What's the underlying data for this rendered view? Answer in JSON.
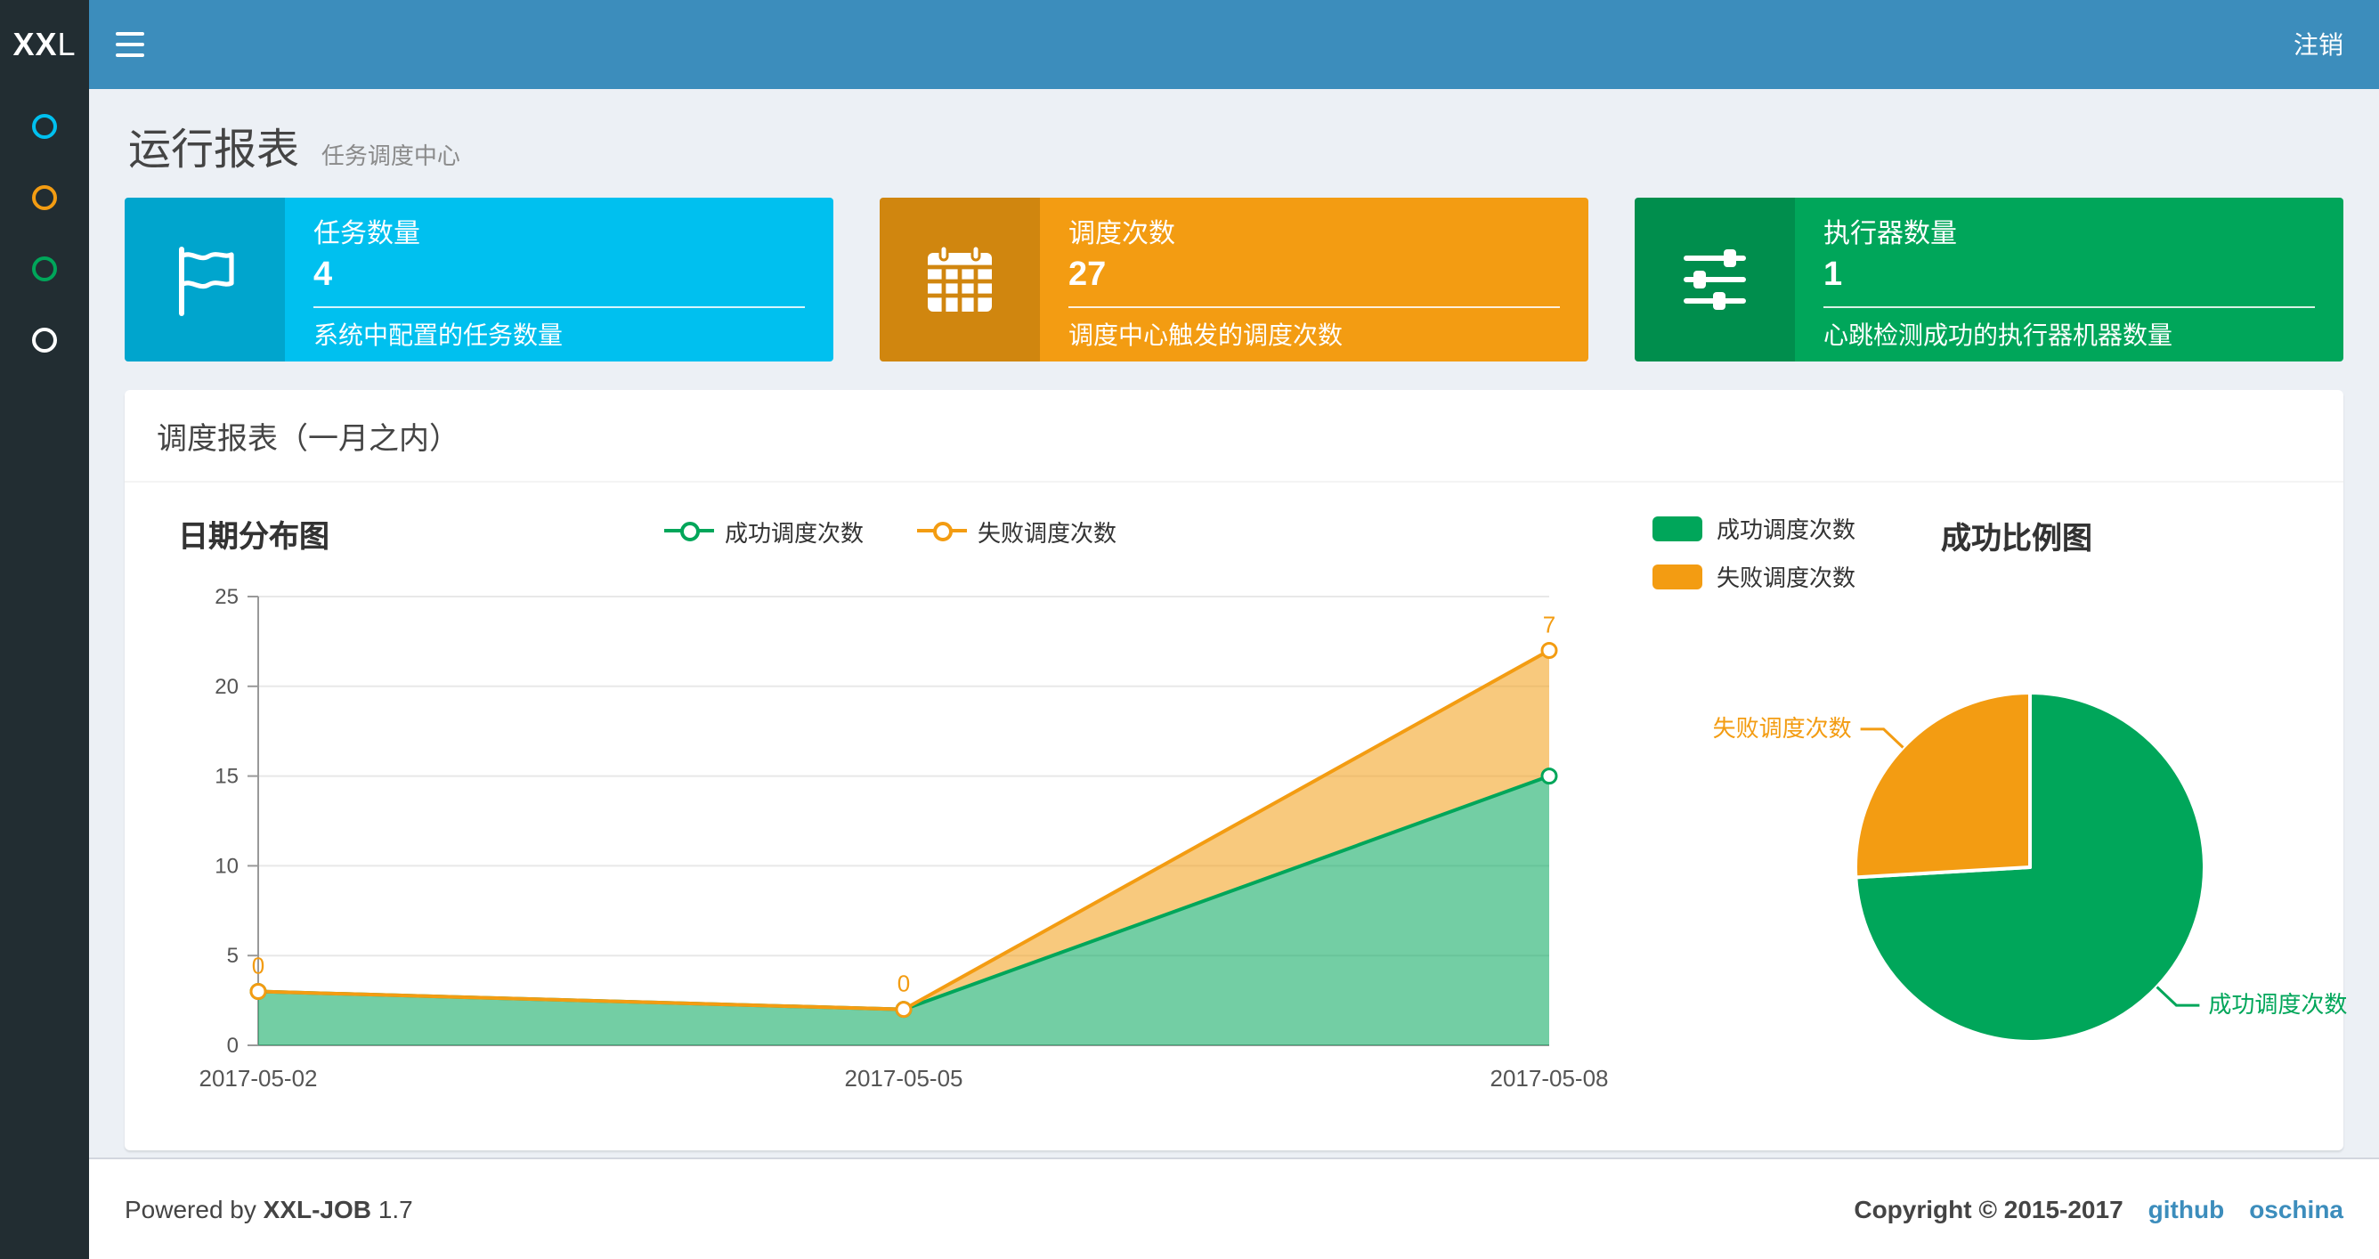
{
  "navbar": {
    "logo_bold": "XX",
    "logo_rest": "L",
    "logout_label": "注销"
  },
  "sidebar": {
    "items": [
      {
        "color": "#00c0ef"
      },
      {
        "color": "#f39c12"
      },
      {
        "color": "#00a65a"
      },
      {
        "color": "#ffffff"
      }
    ]
  },
  "page": {
    "title": "运行报表",
    "subtitle": "任务调度中心"
  },
  "info_boxes": [
    {
      "icon": "flag-icon",
      "label": "任务数量",
      "value": "4",
      "desc": "系统中配置的任务数量",
      "color": "#00c0ef"
    },
    {
      "icon": "calendar-icon",
      "label": "调度次数",
      "value": "27",
      "desc": "调度中心触发的调度次数",
      "color": "#f39c12"
    },
    {
      "icon": "sliders-icon",
      "label": "执行器数量",
      "value": "1",
      "desc": "心跳检测成功的执行器机器数量",
      "color": "#00a65a"
    }
  ],
  "panel": {
    "title": "调度报表（一月之内）"
  },
  "chart_data": [
    {
      "type": "area",
      "title": "日期分布图",
      "stacked": true,
      "x": [
        "2017-05-02",
        "2017-05-05",
        "2017-05-08"
      ],
      "series": [
        {
          "name": "成功调度次数",
          "values": [
            3,
            2,
            15
          ],
          "color": "#00a65a"
        },
        {
          "name": "失败调度次数",
          "values": [
            0,
            0,
            7
          ],
          "color": "#f39c12",
          "point_labels": [
            "0",
            "0",
            "7"
          ]
        }
      ],
      "ylim": [
        0,
        25
      ],
      "yticks": [
        0,
        5,
        10,
        15,
        20,
        25
      ],
      "legend_position": "top",
      "grid": true
    },
    {
      "type": "pie",
      "title": "成功比例图",
      "slices": [
        {
          "name": "成功调度次数",
          "value": 20,
          "color": "#00a65a"
        },
        {
          "name": "失败调度次数",
          "value": 7,
          "color": "#f39c12"
        }
      ],
      "legend_position": "left"
    }
  ],
  "footer": {
    "powered_prefix": "Powered by",
    "brand": "XXL-JOB",
    "version": "1.7",
    "copyright": "Copyright © 2015-2017",
    "links": [
      "github",
      "oschina"
    ]
  }
}
